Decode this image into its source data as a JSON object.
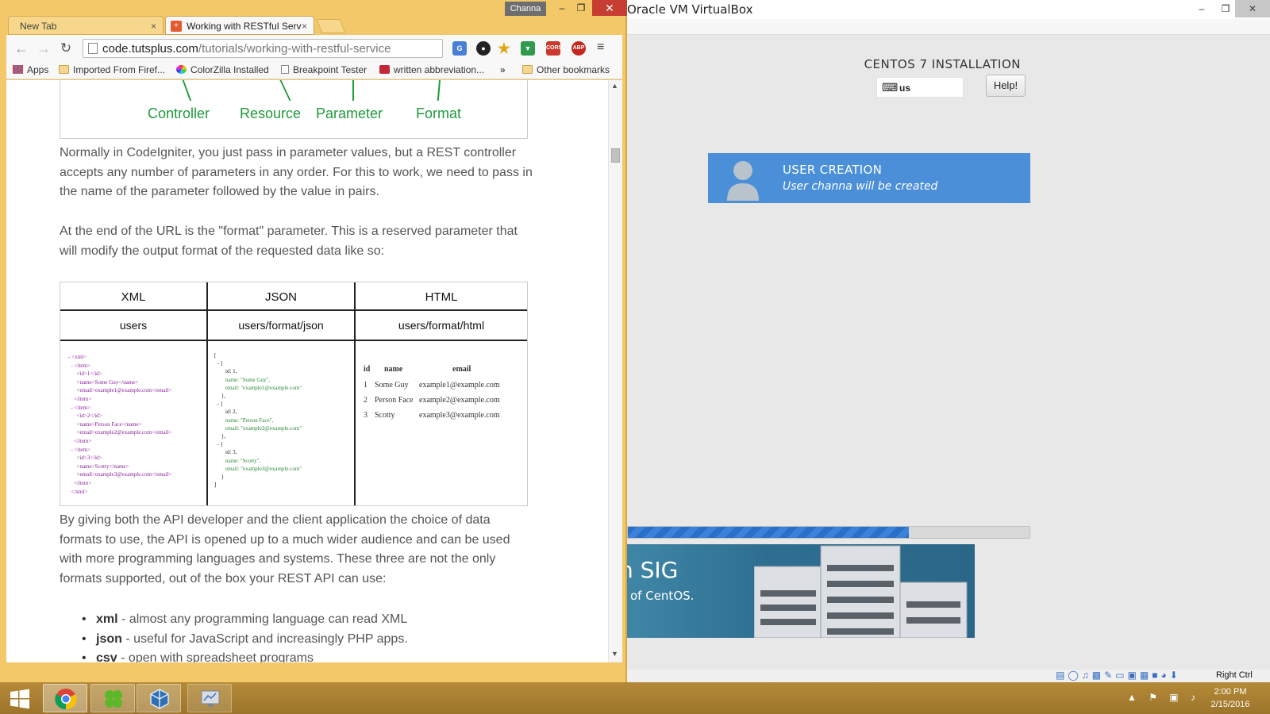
{
  "vbox": {
    "title": "Oracle VM VirtualBox",
    "window_controls": {
      "minimize": "–",
      "maximize": "❐",
      "close": "✕"
    },
    "vm": {
      "install_title": "CENTOS 7 INSTALLATION",
      "keyboard_layout": "us",
      "help_label": "Help!",
      "user_creation_title": "USER CREATION",
      "user_creation_subtitle": "User channa will be created",
      "progress_fraction": 0.7,
      "banner_title": "n SIG",
      "banner_subtitle": "of CentOS."
    },
    "statusbar": {
      "host_key": "Right Ctrl",
      "icons": [
        "hard-disk-icon",
        "optical-disk-icon",
        "audio-icon",
        "network-icon",
        "usb-icon",
        "shared-folders-icon",
        "display-icon",
        "video-capture-icon",
        "virtualization-icon",
        "mouse-integration-icon",
        "host-key-arrow-icon"
      ]
    }
  },
  "chrome": {
    "profile_name": "Channa",
    "window_controls": {
      "minimize": "–",
      "maximize": "❐",
      "close": "✕"
    },
    "tabs": [
      {
        "title": "New Tab",
        "active": false
      },
      {
        "title": "Working with RESTful Serv",
        "active": true
      }
    ],
    "tab_close": "×",
    "toolbar": {
      "back": "←",
      "forward": "→",
      "reload": "↻",
      "url_domain": "code.tutsplus.com",
      "url_path": "/tutorials/working-with-restful-service",
      "extensions": [
        "translate-icon",
        "colorzilla-icon",
        "bookmark-star-icon",
        "chromecast-icon",
        "cors-icon",
        "adblock-plus-icon"
      ],
      "cors_label": "CORS",
      "abp_label": "ABP",
      "menu": "≡"
    },
    "bookmarks": [
      {
        "label": "Apps"
      },
      {
        "label": "Imported From Firef..."
      },
      {
        "label": "ColorZilla Installed"
      },
      {
        "label": "Breakpoint Tester"
      },
      {
        "label": "written abbreviation..."
      },
      {
        "label": "»"
      },
      {
        "label": "Other bookmarks"
      }
    ]
  },
  "article": {
    "diagram_words": [
      "Controller",
      "Resource",
      "Parameter",
      "Format"
    ],
    "para1": "Normally in CodeIgniter, you just pass in parameter values, but a REST controller accepts any number of parameters in any order. For this to work, we need to pass in the name of the parameter followed by the value in pairs.",
    "para2": "At the end of the URL is the \"format\" parameter. This is a reserved parameter that will modify the output format of the requested data like so:",
    "table": {
      "headers": [
        "XML",
        "JSON",
        "HTML"
      ],
      "paths": [
        "users",
        "users/format/json",
        "users/format/html"
      ],
      "xml_lines": [
        "- <xml>",
        "  - <item>",
        "      <id>1</id>",
        "      <name>Some Guy</name>",
        "      <email>example1@example.com</email>",
        "    </item>",
        "  - <item>",
        "      <id>2</id>",
        "      <name>Person Face</name>",
        "      <email>example2@example.com</email>",
        "    </item>",
        "  - <item>",
        "      <id>3</id>",
        "      <name>Scotty</name>",
        "      <email>example3@example.com</email>",
        "    </item>",
        "  </xml>"
      ],
      "json_lines": [
        "[",
        "  - {",
        "        id: 1,",
        "        name: \"Some Guy\",",
        "        email: \"example1@example.com\"",
        "     },",
        "  - {",
        "        id: 2,",
        "        name: \"Person Face\",",
        "        email: \"example2@example.com\"",
        "     },",
        "  - {",
        "        id: 3,",
        "        name: \"Scotty\",",
        "        email: \"example3@example.com\"",
        "     }",
        "]"
      ],
      "html_headers": [
        "id",
        "name",
        "email"
      ],
      "html_rows": [
        [
          "1",
          "Some Guy",
          "example1@example.com"
        ],
        [
          "2",
          "Person Face",
          "example2@example.com"
        ],
        [
          "3",
          "Scotty",
          "example3@example.com"
        ]
      ]
    },
    "para3": "By giving both the API developer and the client application the choice of data formats to use, the API is opened up to a much wider audience and can be used with more programming languages and systems. These three are not the only formats supported, out of the box your REST API can use:",
    "bullets": [
      {
        "term": "xml",
        "text": " - almost any programming language can read XML"
      },
      {
        "term": "json",
        "text": " - useful for JavaScript and increasingly PHP apps."
      },
      {
        "term": "csv",
        "text": " - open with spreadsheet programs"
      }
    ]
  },
  "taskbar": {
    "apps": [
      "chrome-icon",
      "clover-icon",
      "virtualbox-icon",
      "monitor-icon"
    ],
    "tray": "▲ ⚑ ▣ ♪",
    "time": "2:00 PM",
    "date": "2/15/2016"
  }
}
